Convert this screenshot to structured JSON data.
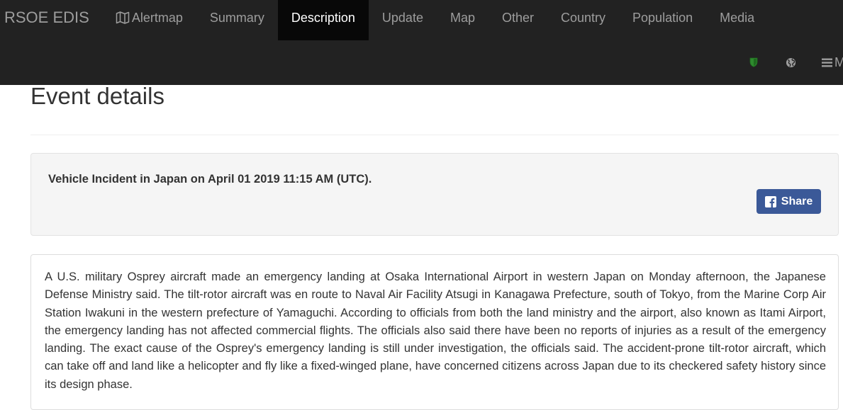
{
  "navbar": {
    "brand": "RSOE EDIS",
    "items": [
      {
        "label": "Alertmap",
        "icon": "map-icon",
        "active": false
      },
      {
        "label": "Summary",
        "active": false
      },
      {
        "label": "Description",
        "active": true
      },
      {
        "label": "Update",
        "active": false
      },
      {
        "label": "Map",
        "active": false
      },
      {
        "label": "Other",
        "active": false
      },
      {
        "label": "Country",
        "active": false
      },
      {
        "label": "Population",
        "active": false
      },
      {
        "label": "Media",
        "active": false
      }
    ],
    "right": {
      "shield_icon": "shield-icon",
      "globe_icon": "globe-icon",
      "menu_icon": "menu-icon",
      "menu_label": "Me"
    }
  },
  "page": {
    "title": "Event details"
  },
  "event": {
    "heading": "Vehicle Incident in Japan on April 01 2019 11:15 AM (UTC).",
    "share_label": "Share",
    "share_icon": "facebook-icon",
    "description": "A U.S. military Osprey aircraft made an emergency landing at Osaka International Airport in western Japan on Monday afternoon, the Japanese Defense Ministry said. The tilt-rotor aircraft was en route to Naval Air Facility Atsugi in Kanagawa Prefecture, south of Tokyo, from the Marine Corp Air Station Iwakuni in the western prefecture of Yamaguchi. According to officials from both the land ministry and the airport, also known as Itami Airport, the emergency landing has not affected commercial flights. The officials also said there have been no reports of injuries as a result of the emergency landing. The exact cause of the Osprey's emergency landing is still under investigation, the officials said. The accident-prone tilt-rotor aircraft, which can take off and land like a helicopter and fly like a fixed-winged plane, have concerned citizens across Japan due to its checkered safety history since its design phase."
  },
  "colors": {
    "navbar_bg": "#222222",
    "navbar_active_bg": "#080808",
    "navbar_text": "#9d9d9d",
    "shield_green": "#2e8b2e",
    "share_blue": "#3b5998"
  }
}
